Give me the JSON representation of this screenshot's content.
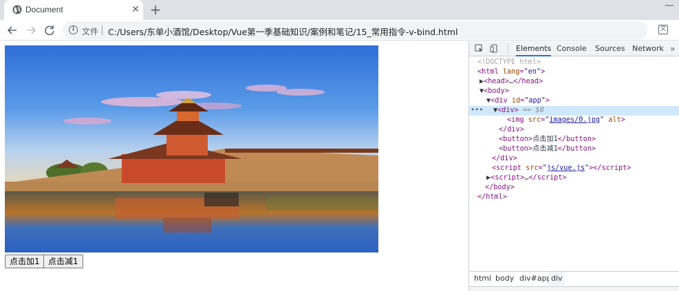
{
  "browser": {
    "tab_title": "Document",
    "tab_close_glyph": "✕",
    "new_tab_glyph": "+",
    "scheme_label": "文件",
    "url": "C:/Users/东单小酒馆/Desktop/Vue第一季基础知识/案例和笔记/15_常用指令-v-bind.html",
    "icons": [
      "globe-icon",
      "close-icon",
      "plus-icon",
      "back-arrow-icon",
      "forward-arrow-icon",
      "reload-icon",
      "info-icon",
      "translate-icon",
      "minimize-icon"
    ]
  },
  "page": {
    "image_alt": "",
    "buttons": [
      "点击加1",
      "点击减1"
    ]
  },
  "devtools": {
    "tabs": [
      "Elements",
      "Console",
      "Sources",
      "Network"
    ],
    "active_tab": "Elements",
    "more_glyph": "»",
    "dom": {
      "doctype": "<!DOCTYPE html>",
      "html_open": "html",
      "lang_attr": "lang",
      "lang_val": "\"en\"",
      "head": "head",
      "head_ellipsis": "…",
      "body": "body",
      "div_app": "div",
      "id_attr": "id",
      "id_val": "\"app\"",
      "selected_div": "div",
      "selected_suffix": " == $0",
      "img_src_val": "images/0.jpg",
      "button1_text": "点击加1",
      "button2_text": "点击减1",
      "script_src_val": "js/vue.js",
      "script_ellipsis": "…"
    },
    "breadcrumbs": [
      "html",
      "body",
      "div#app",
      "div"
    ]
  },
  "colors": {
    "tab_strip": "#dee1e6",
    "selection": "#cfe8fc",
    "tag": "#881280",
    "attr_name": "#994500",
    "attr_value": "#1a1aa6",
    "accent": "#1a73e8"
  }
}
